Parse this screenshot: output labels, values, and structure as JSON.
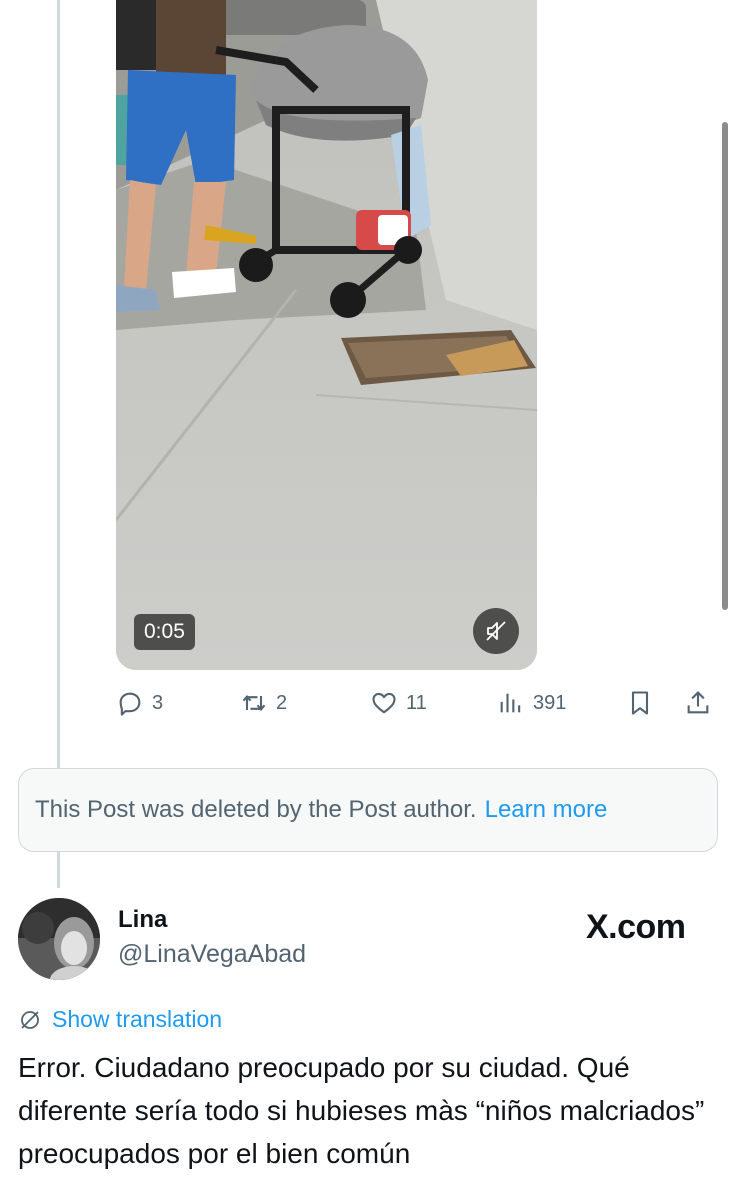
{
  "video": {
    "timestamp": "0:05",
    "mute_icon": "speaker-muted-icon"
  },
  "actions": {
    "replies": "3",
    "reposts": "2",
    "likes": "11",
    "views": "391"
  },
  "deleted_notice": {
    "text": "This Post was deleted by the Post author.",
    "link": "Learn more"
  },
  "reply": {
    "name": "Lina",
    "handle": "@LinaVegaAbad",
    "watermark": "X.com",
    "translate_label": "Show translation",
    "text": "Error. Ciudadano preocupado por su ciudad. Qué diferente sería todo si hubieses màs “niños malcriados” preocupados por el bien común"
  },
  "colors": {
    "accent": "#1d9bf0",
    "muted_text": "#536471",
    "border": "#cfd9de"
  }
}
